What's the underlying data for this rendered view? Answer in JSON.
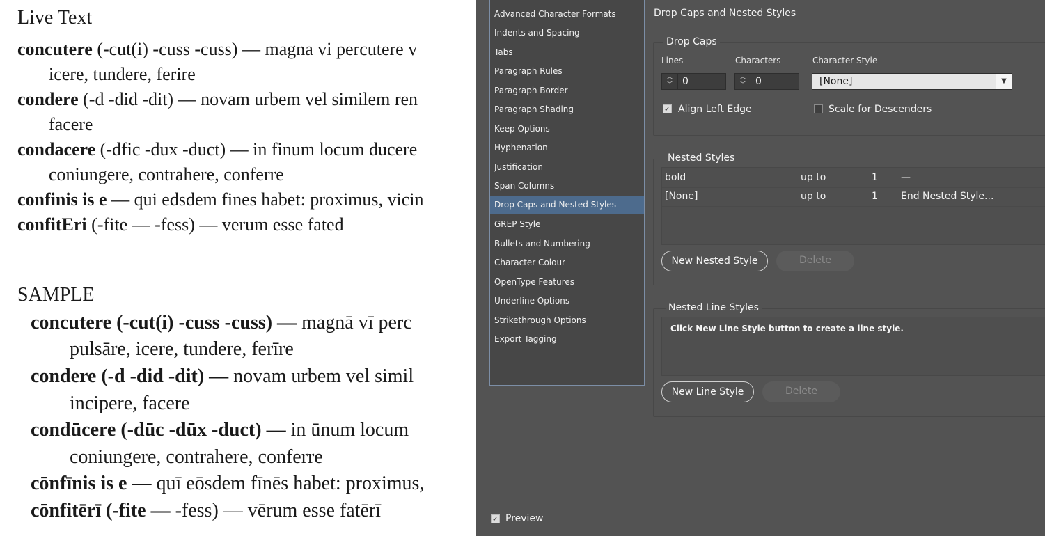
{
  "document": {
    "live_heading": "Live Text",
    "live_entries": [
      {
        "head": "concutere",
        "forms": " (-cut(i) -cuss -cuss)",
        "def": " — magna vi percutere v",
        "cont": "icere, tundere, ferire"
      },
      {
        "head": "condere",
        "forms": " (-d -did -dit)",
        "def": " — novam urbem vel similem ren",
        "cont": "facere"
      },
      {
        "head": "condacere",
        "forms": " (-dfic -dux -duct)",
        "def": " — in finum locum ducere",
        "cont": "coniungere, contrahere, conferre"
      },
      {
        "head": "confinis is e",
        "forms": "",
        "def": " — qui edsdem fines habet: proximus, vicin",
        "cont": ""
      },
      {
        "head": "confitEri",
        "forms": " (-fite",
        "def": " — -fess) — verum esse fated",
        "cont": ""
      }
    ],
    "sample_heading": "SAMPLE",
    "sample_entries": [
      {
        "bold": "concutere (-cut(i) -cuss -cuss) —",
        "rest": " magnā vī perc",
        "cont": "pulsāre, icere, tundere, ferīre"
      },
      {
        "bold": "condere (-d -did -dit) —",
        "rest": " novam urbem vel simil",
        "cont": "incipere, facere"
      },
      {
        "bold": "condūcere (-dūc -dūx -duct)",
        "rest": " — in ūnum locum",
        "cont": "coniungere, contrahere, conferre"
      },
      {
        "bold": "cōnfīnis is e",
        "rest": " — quī eōsdem fīnēs habet: proximus,",
        "cont": ""
      },
      {
        "bold": "cōnfitērī (-fite —",
        "rest": " -fess) — vērum esse fatērī",
        "cont": ""
      }
    ]
  },
  "dialog": {
    "sidebar": [
      "Advanced Character Formats",
      "Indents and Spacing",
      "Tabs",
      "Paragraph Rules",
      "Paragraph Border",
      "Paragraph Shading",
      "Keep Options",
      "Hyphenation",
      "Justification",
      "Span Columns",
      "Drop Caps and Nested Styles",
      "GREP Style",
      "Bullets and Numbering",
      "Character Colour",
      "OpenType Features",
      "Underline Options",
      "Strikethrough Options",
      "Export Tagging"
    ],
    "selected_index": 10,
    "pane_title": "Drop Caps and Nested Styles",
    "drop_caps": {
      "title": "Drop Caps",
      "lines_label": "Lines",
      "lines_value": "0",
      "characters_label": "Characters",
      "characters_value": "0",
      "char_style_label": "Character Style",
      "char_style_value": "[None]",
      "align_left_edge": "Align Left Edge",
      "align_left_edge_checked": true,
      "scale_descenders": "Scale for Descenders",
      "scale_descenders_checked": false
    },
    "nested_styles": {
      "title": "Nested Styles",
      "rows": [
        {
          "style": "bold",
          "mode": "up to",
          "count": "1",
          "end": "—"
        },
        {
          "style": "[None]",
          "mode": "up to",
          "count": "1",
          "end": "End Nested Style..."
        }
      ],
      "new_button": "New Nested Style",
      "delete_button": "Delete"
    },
    "nested_line_styles": {
      "title": "Nested Line Styles",
      "hint": "Click New Line Style button to create a line style.",
      "new_button": "New Line Style",
      "delete_button": "Delete"
    },
    "preview_label": "Preview",
    "preview_checked": true,
    "colors": {
      "panel": "#535353",
      "selected": "#4d6b8d"
    }
  }
}
